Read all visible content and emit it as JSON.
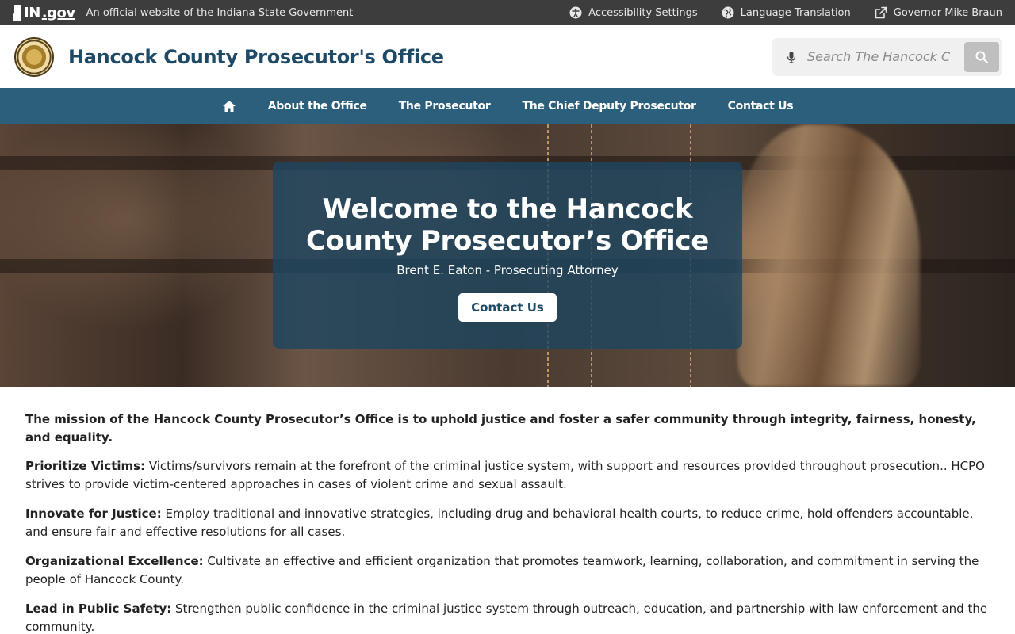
{
  "topbar": {
    "logo_text_in": "IN",
    "logo_text_gov": ".gov",
    "official_text": "An official website of the Indiana State Government",
    "links": [
      {
        "label": "Accessibility Settings",
        "icon": "accessibility-icon"
      },
      {
        "label": "Language Translation",
        "icon": "globe-icon"
      },
      {
        "label": "Governor Mike Braun",
        "icon": "external-link-icon"
      }
    ]
  },
  "header": {
    "title": "Hancock County Prosecutor's Office",
    "seal_icon": "county-seal-icon",
    "search": {
      "placeholder": "Search The Hancock C",
      "value": ""
    }
  },
  "nav": {
    "home_icon": "home-icon",
    "items": [
      {
        "label": "About the Office"
      },
      {
        "label": "The Prosecutor"
      },
      {
        "label": "The Chief Deputy Prosecutor"
      },
      {
        "label": "Contact Us"
      }
    ]
  },
  "hero": {
    "title": "Welcome to the Hancock County Prosecutor’s Office",
    "subtitle": "Brent E. Eaton - Prosecuting Attorney",
    "button_label": "Contact Us"
  },
  "content": {
    "mission": "The mission of the Hancock County Prosecutor’s Office is to uphold justice and foster a safer community through integrity, fairness, honesty, and equality.",
    "items": [
      {
        "heading": "Prioritize Victims:",
        "text": " Victims/survivors remain at the forefront of the criminal justice system, with support and resources provided throughout prosecution.. HCPO strives to provide victim-centered approaches in cases of violent crime and sexual assault."
      },
      {
        "heading": "Innovate for Justice:",
        "text": " Employ traditional and innovative strategies, including drug and behavioral health courts, to reduce crime, hold offenders accountable, and ensure fair and effective resolutions for all cases."
      },
      {
        "heading": "Organizational Excellence:",
        "text": " Cultivate an effective and efficient organization that promotes teamwork, learning, collaboration, and commitment in serving the people of Hancock County."
      },
      {
        "heading": "Lead in Public Safety:",
        "text": " Strengthen public confidence in the criminal justice system through outreach, education, and partnership with law enforcement and the community."
      }
    ]
  },
  "colors": {
    "topbar_bg": "#3d3d3d",
    "title_color": "#1e4a66",
    "nav_bg": "#2c5f7c",
    "hero_card_bg": "#1e465f"
  }
}
